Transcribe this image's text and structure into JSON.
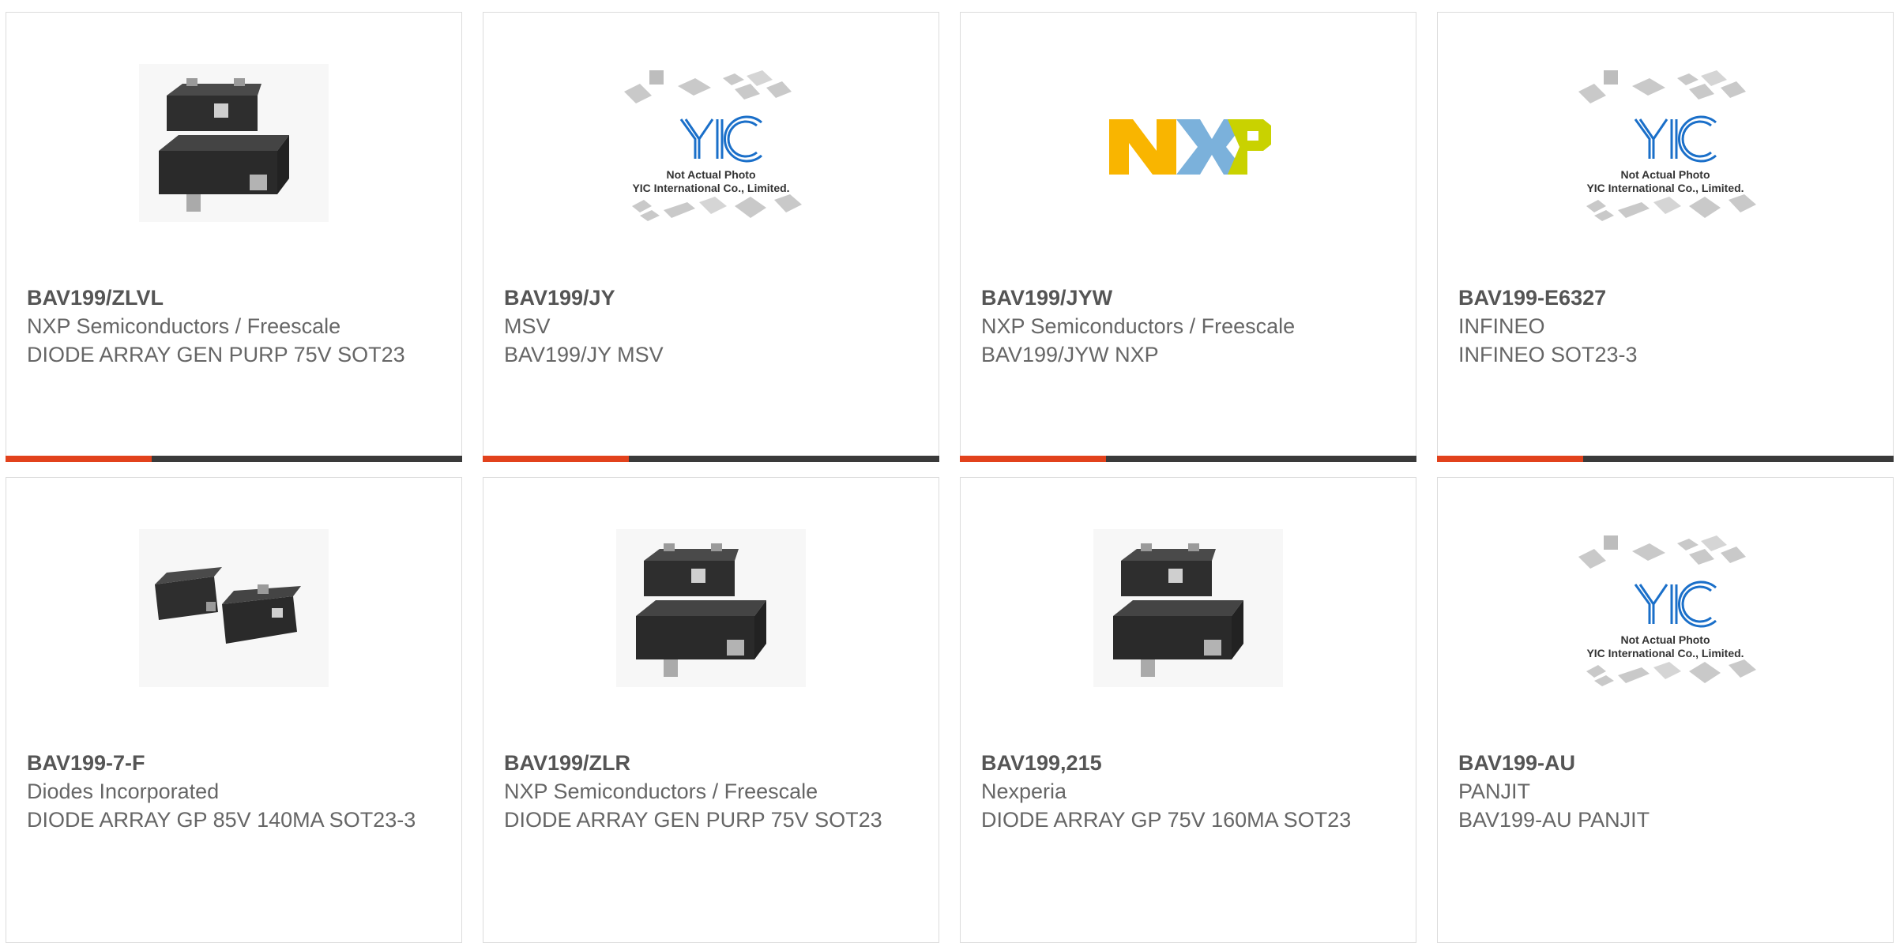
{
  "products": [
    {
      "part": "BAV199/ZLVL",
      "mfr": "NXP Semiconductors / Freescale",
      "desc": "DIODE ARRAY GEN PURP 75V SOT23",
      "image": "sot23-chip"
    },
    {
      "part": "BAV199/JY",
      "mfr": "MSV",
      "desc": "BAV199/JY MSV",
      "image": "yic-placeholder"
    },
    {
      "part": "BAV199/JYW",
      "mfr": "NXP Semiconductors / Freescale",
      "desc": "BAV199/JYW NXP",
      "image": "nxp-logo"
    },
    {
      "part": "BAV199-E6327",
      "mfr": "INFINEO",
      "desc": "INFINEO SOT23-3",
      "image": "yic-placeholder"
    },
    {
      "part": "BAV199-7-F",
      "mfr": "Diodes Incorporated",
      "desc": "DIODE ARRAY GP 85V 140MA SOT23-3",
      "image": "sot23-pair"
    },
    {
      "part": "BAV199/ZLR",
      "mfr": "NXP Semiconductors / Freescale",
      "desc": "DIODE ARRAY GEN PURP 75V SOT23",
      "image": "sot23-chip"
    },
    {
      "part": "BAV199,215",
      "mfr": "Nexperia",
      "desc": "DIODE ARRAY GP 75V 160MA SOT23",
      "image": "sot23-chip"
    },
    {
      "part": "BAV199-AU",
      "mfr": "PANJIT",
      "desc": "BAV199-AU PANJIT",
      "image": "yic-placeholder"
    }
  ],
  "placeholder": {
    "logo": "YIC",
    "line1": "Not Actual Photo",
    "line2": "YIC International Co., Limited."
  },
  "nxp_logo": {
    "text": "NXP",
    "colors": [
      "#f9b500",
      "#7bb1db",
      "#c9d200"
    ]
  },
  "colors": {
    "accent": "#e2421c",
    "bar": "#3a3a3a",
    "border": "#dcdcdc"
  }
}
